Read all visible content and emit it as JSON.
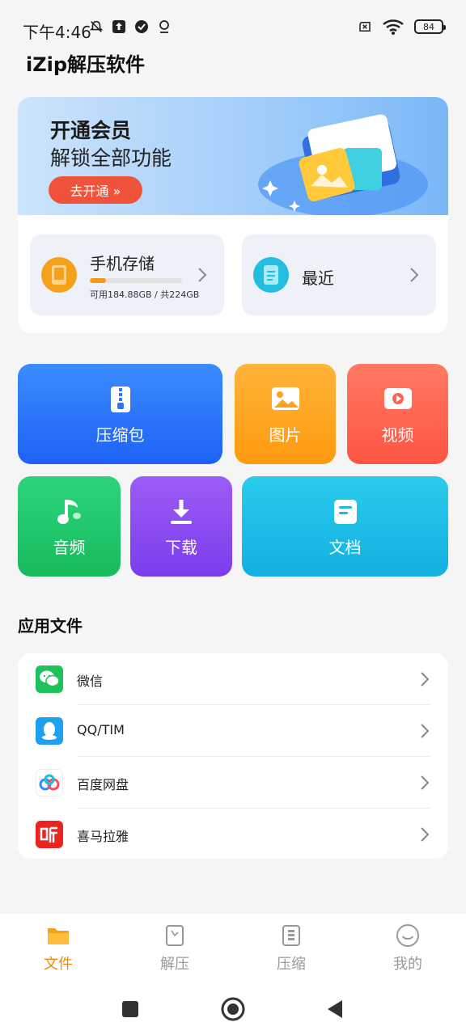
{
  "status_bar": {
    "time": "下午4:46",
    "battery": "84"
  },
  "app": {
    "title": "iZip解压软件"
  },
  "banner": {
    "title": "开通会员",
    "subtitle": "解锁全部功能",
    "button": "去开通 »"
  },
  "storage": {
    "label": "手机存储",
    "info": "可用184.88GB / 共224GB",
    "used_fraction": 0.175
  },
  "recent": {
    "label": "最近"
  },
  "categories": [
    {
      "label": "压缩包",
      "icon": "zip-icon",
      "color": "#2f74ff"
    },
    {
      "label": "图片",
      "icon": "image-icon",
      "color": "#ffa21c"
    },
    {
      "label": "视频",
      "icon": "video-icon",
      "color": "#ff6352"
    },
    {
      "label": "音频",
      "icon": "music-icon",
      "color": "#22c46a"
    },
    {
      "label": "下载",
      "icon": "download-icon",
      "color": "#8a4ef0"
    },
    {
      "label": "文档",
      "icon": "document-icon",
      "color": "#1fb8e6"
    }
  ],
  "app_files": {
    "title": "应用文件",
    "items": [
      {
        "name": "微信",
        "icon": "wechat-icon"
      },
      {
        "name": "QQ/TIM",
        "icon": "qq-icon"
      },
      {
        "name": "百度网盘",
        "icon": "baidu-netdisk-icon"
      },
      {
        "name": "喜马拉雅",
        "icon": "ximalaya-icon"
      }
    ]
  },
  "bottom_nav": [
    {
      "label": "文件",
      "active": true
    },
    {
      "label": "解压",
      "active": false
    },
    {
      "label": "压缩",
      "active": false
    },
    {
      "label": "我的",
      "active": false
    }
  ],
  "colors": {
    "accent": "#f08a10",
    "banner_button": "#f0533b"
  }
}
